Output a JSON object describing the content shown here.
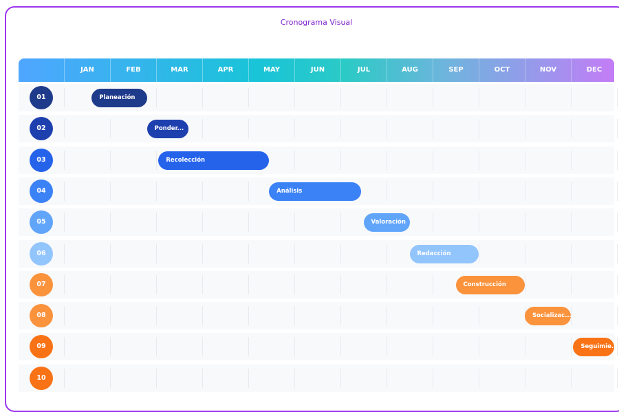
{
  "title": "Cronograma Visual",
  "months": [
    "JAN",
    "FEB",
    "MAR",
    "APR",
    "MAY",
    "JUN",
    "JUL",
    "AUG",
    "SEP",
    "OCT",
    "NOV",
    "DEC"
  ],
  "rows": [
    {
      "num": "01",
      "color": "#1e3a8a",
      "task": {
        "label": "Planeación",
        "color": "#1e3a8a",
        "start": 0.6,
        "end": 1.8
      }
    },
    {
      "num": "02",
      "color": "#1e40af",
      "task": {
        "label": "Ponder...",
        "color": "#1e40af",
        "start": 1.8,
        "end": 2.7
      }
    },
    {
      "num": "03",
      "color": "#2563eb",
      "task": {
        "label": "Recolección",
        "color": "#2563eb",
        "start": 2.05,
        "end": 4.45
      }
    },
    {
      "num": "04",
      "color": "#3b82f6",
      "task": {
        "label": "Análisis",
        "color": "#3b82f6",
        "start": 4.45,
        "end": 6.45
      }
    },
    {
      "num": "05",
      "color": "#60a5fa",
      "task": {
        "label": "Valoración",
        "color": "#60a5fa",
        "start": 6.5,
        "end": 7.5
      }
    },
    {
      "num": "06",
      "color": "#93c5fd",
      "task": {
        "label": "Redacción",
        "color": "#93c5fd",
        "start": 7.5,
        "end": 9.0
      }
    },
    {
      "num": "07",
      "color": "#fb923c",
      "task": {
        "label": "Construcción",
        "color": "#fb923c",
        "start": 8.5,
        "end": 10.0
      }
    },
    {
      "num": "08",
      "color": "#fb923c",
      "task": {
        "label": "Socializac...",
        "color": "#fb923c",
        "start": 10.0,
        "end": 11.0
      }
    },
    {
      "num": "09",
      "color": "#f97316",
      "task": {
        "label": "Seguimie...",
        "color": "#f97316",
        "start": 11.05,
        "end": 12.0
      }
    },
    {
      "num": "10",
      "color": "#f97316",
      "task": null
    }
  ]
}
